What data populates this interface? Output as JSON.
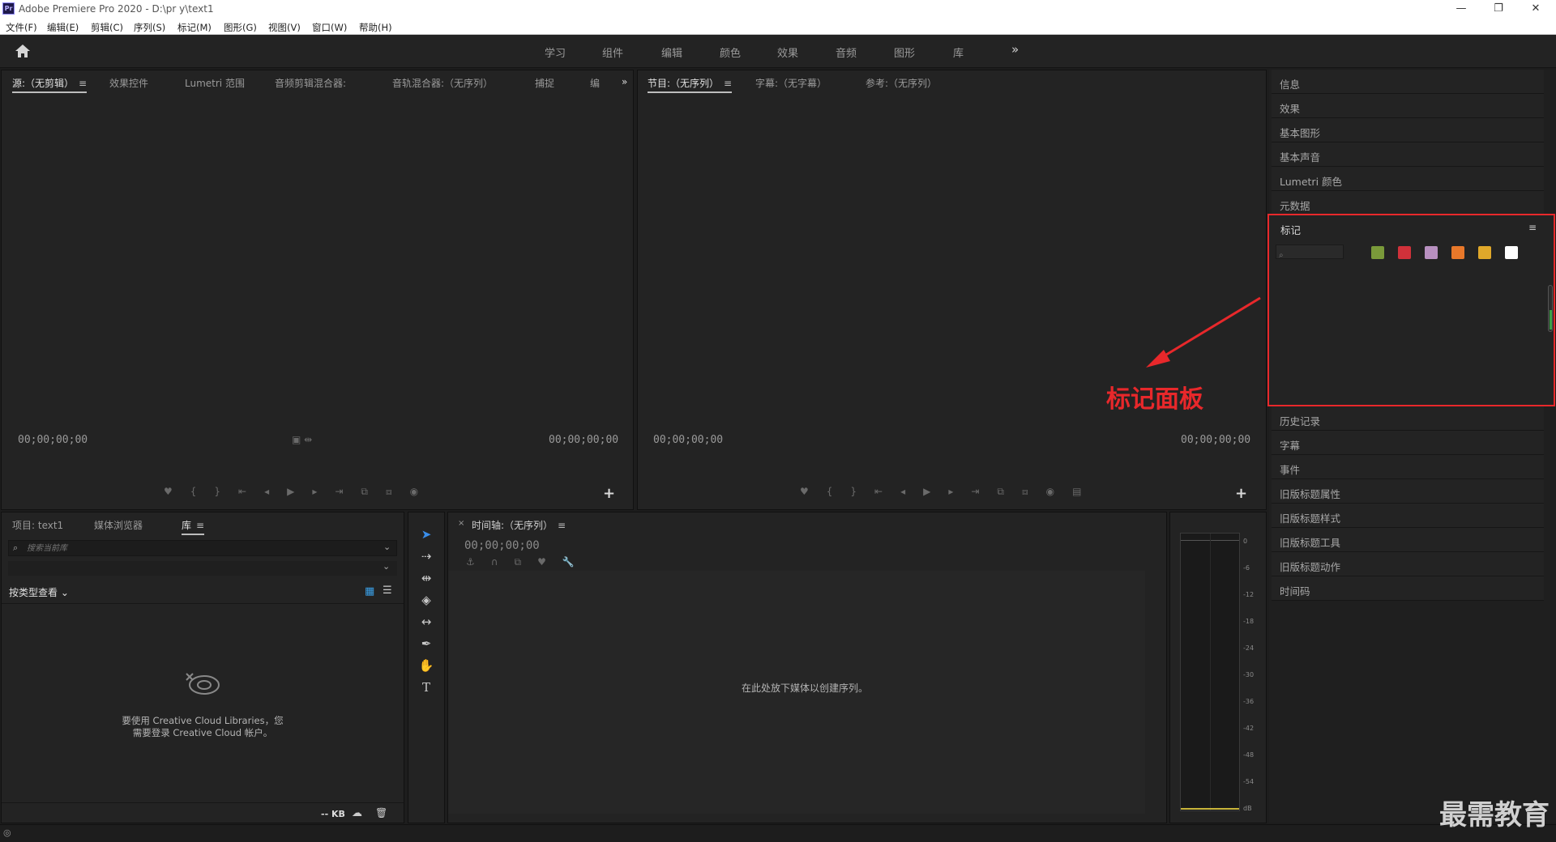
{
  "window": {
    "title": "Adobe Premiere Pro 2020 - D:\\pr y\\text1",
    "logo_text": "Pr",
    "minimize": "—",
    "restore": "❐",
    "close": "✕"
  },
  "menu": [
    "文件(F)",
    "编辑(E)",
    "剪辑(C)",
    "序列(S)",
    "标记(M)",
    "图形(G)",
    "视图(V)",
    "窗口(W)",
    "帮助(H)"
  ],
  "workspaces": [
    "学习",
    "组件",
    "编辑",
    "颜色",
    "效果",
    "音频",
    "图形",
    "库"
  ],
  "workspaces_more": "»",
  "source_panel": {
    "tabs": [
      "源:（无剪辑）",
      "效果控件",
      "Lumetri 范围",
      "音频剪辑混合器:",
      "音轨混合器:（无序列）",
      "捕捉",
      "编"
    ],
    "more": "»",
    "tc_left": "00;00;00;00",
    "tc_right": "00;00;00;00"
  },
  "program_panel": {
    "tabs": [
      "节目:（无序列）",
      "字幕:（无字幕）",
      "参考:（无序列）"
    ],
    "tc_left": "00;00;00;00",
    "tc_right": "00;00;00;00"
  },
  "right_panels_top": [
    "信息",
    "效果",
    "基本图形",
    "基本声音",
    "Lumetri 颜色",
    "元数据"
  ],
  "markers_panel": {
    "title": "标记",
    "menu": "≡",
    "swatch_colors": [
      "#7a9a3a",
      "#d0313a",
      "#b890c0",
      "#e8782a",
      "#e0a82a",
      "#ffffff"
    ]
  },
  "right_panels_bottom": [
    "历史记录",
    "字幕",
    "事件",
    "旧版标题属性",
    "旧版标题样式",
    "旧版标题工具",
    "旧版标题动作",
    "时间码"
  ],
  "annotation": "标记面板",
  "project_panel": {
    "tabs": [
      "项目: text1",
      "媒体浏览器",
      "库"
    ],
    "search_placeholder": "搜索当前库",
    "view_by": "按类型查看",
    "cc_message_line1": "要使用 Creative Cloud Libraries，您",
    "cc_message_line2": "需要登录 Creative Cloud 帐户。",
    "size": "-- KB"
  },
  "timeline_panel": {
    "tab": "时间轴:（无序列）",
    "timecode": "00;00;00;00",
    "drop_hint": "在此处放下媒体以创建序列。"
  },
  "audio_meter": {
    "ticks": [
      "0",
      "-6",
      "-12",
      "-18",
      "-24",
      "-30",
      "-36",
      "-42",
      "-48",
      "-54",
      "dB"
    ]
  },
  "watermark": "最需教育"
}
